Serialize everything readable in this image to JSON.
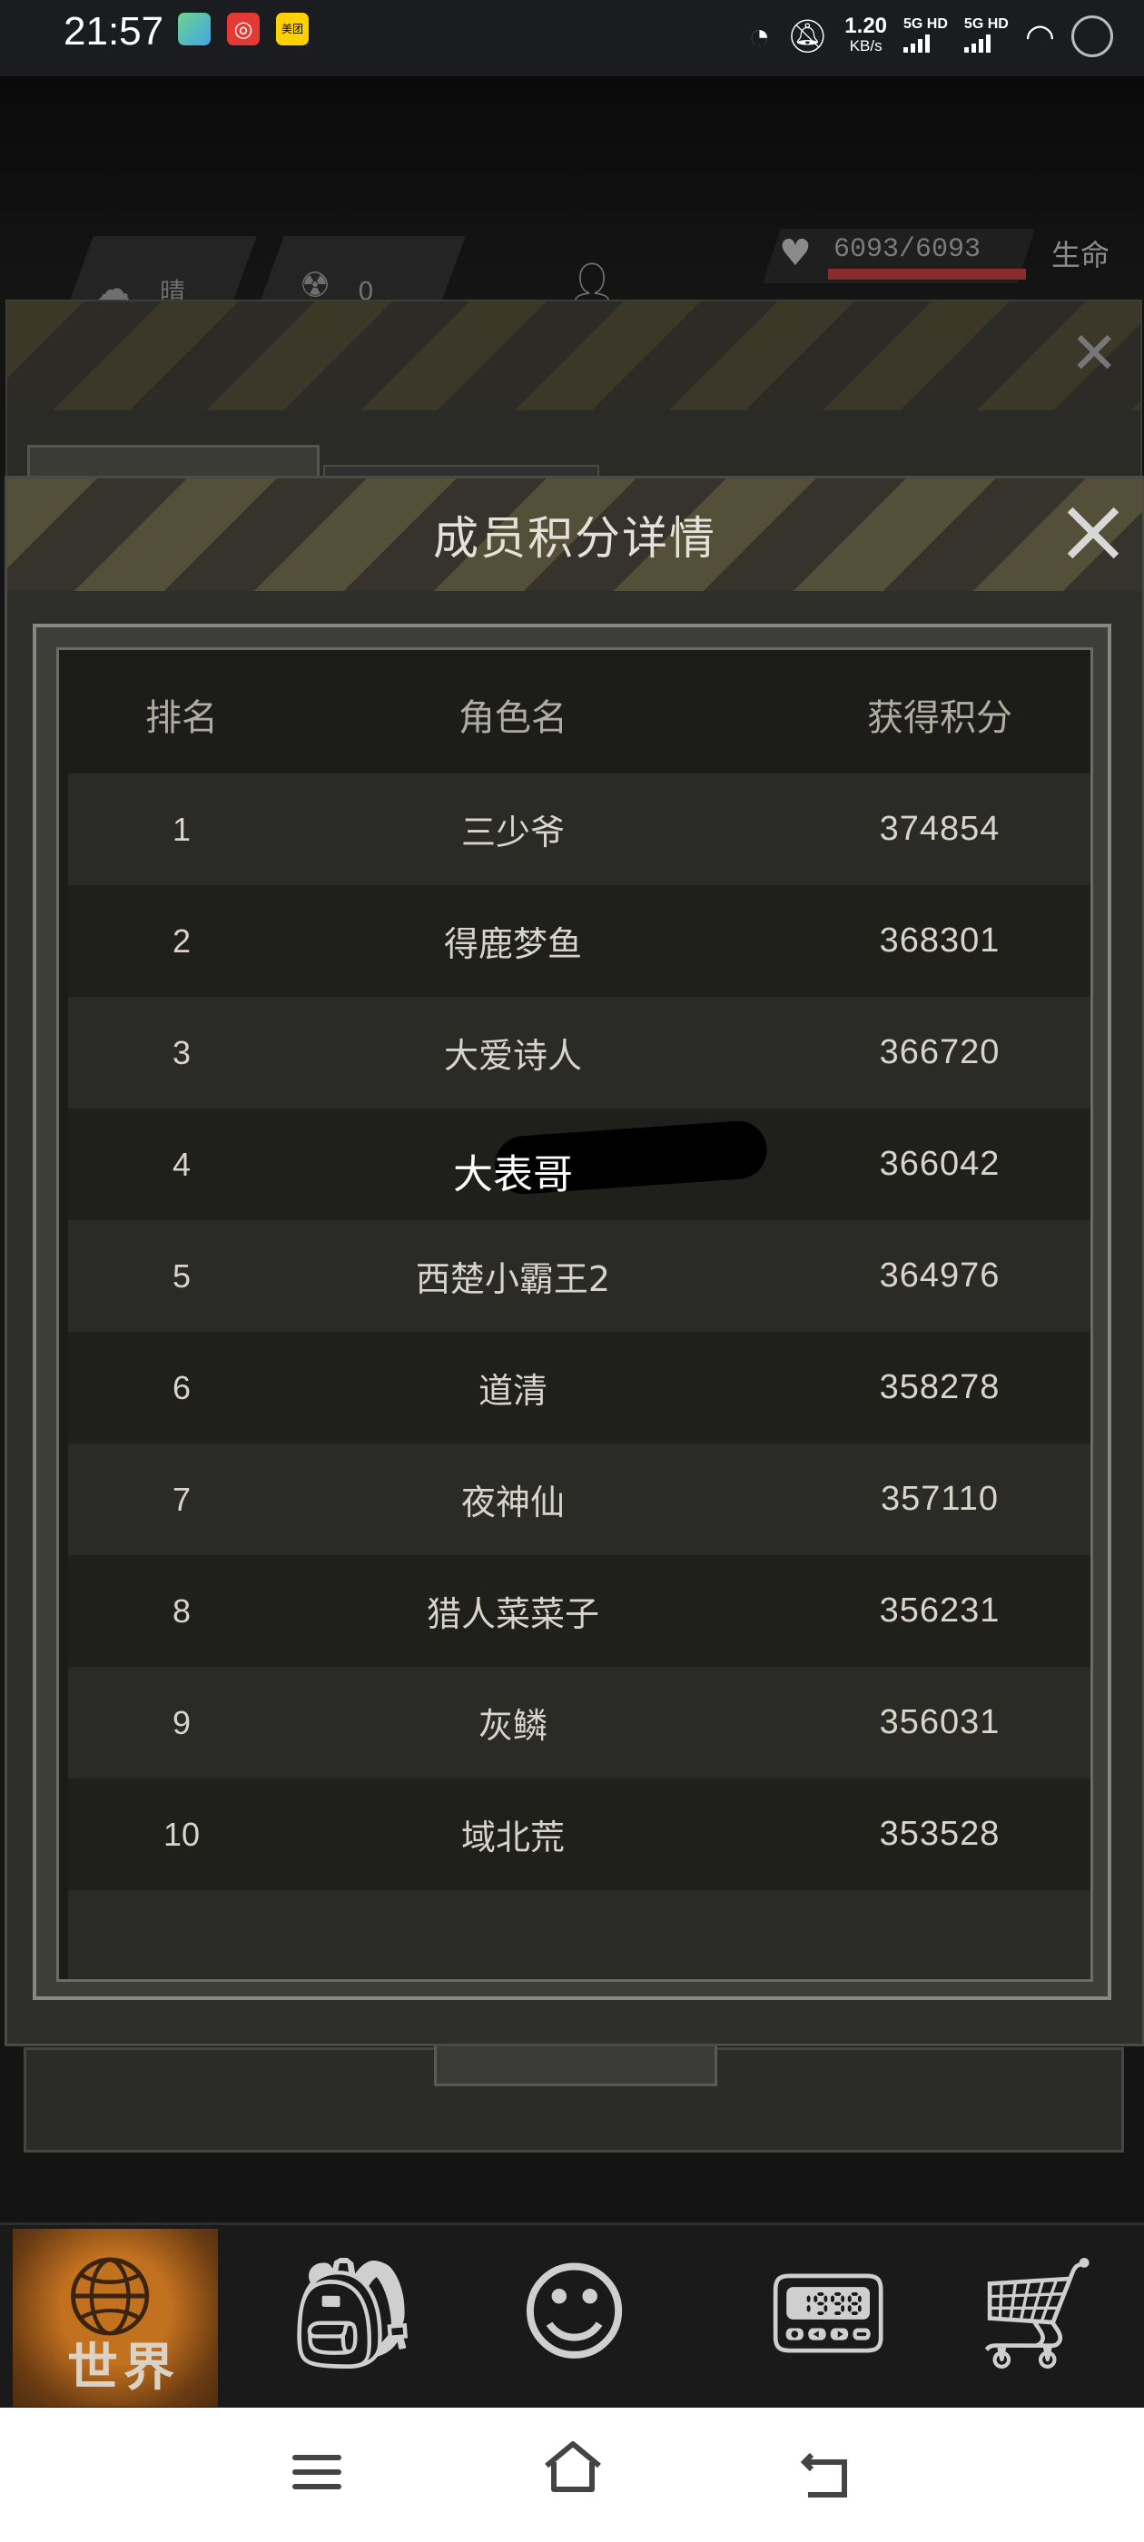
{
  "status_bar": {
    "time": "21:57",
    "apps": [
      "美团"
    ],
    "speed_value": "1.20",
    "speed_unit": "KB/s",
    "network_1": "5G HD",
    "network_2": "5G HD"
  },
  "game_hud": {
    "weather": "晴",
    "radiation": "0",
    "hp": "6093/6093",
    "hp_label": "生命"
  },
  "modal": {
    "title": "成员积分详情",
    "columns": {
      "rank": "排名",
      "name": "角色名",
      "score": "获得积分"
    },
    "rows": [
      {
        "rank": "1",
        "name": "三少爷",
        "score": "374854"
      },
      {
        "rank": "2",
        "name": "得鹿梦鱼",
        "score": "368301"
      },
      {
        "rank": "3",
        "name": "大爱诗人",
        "score": "366720"
      },
      {
        "rank": "4",
        "name": "大表哥",
        "score": "366042"
      },
      {
        "rank": "5",
        "name": "西楚小霸王2",
        "score": "364976"
      },
      {
        "rank": "6",
        "name": "道清",
        "score": "358278"
      },
      {
        "rank": "7",
        "name": "夜神仙",
        "score": "357110"
      },
      {
        "rank": "8",
        "name": "猎人菜菜子",
        "score": "356231"
      },
      {
        "rank": "9",
        "name": "灰鳞",
        "score": "356031"
      },
      {
        "rank": "10",
        "name": "域北荒",
        "score": "353528"
      }
    ]
  },
  "game_nav": {
    "world_label": "世界",
    "icons": [
      "backpack-icon",
      "head-gear-icon",
      "radio-icon",
      "cart-icon"
    ]
  },
  "system_nav": {
    "icons": [
      "menu-icon",
      "home-icon",
      "back-icon"
    ]
  }
}
